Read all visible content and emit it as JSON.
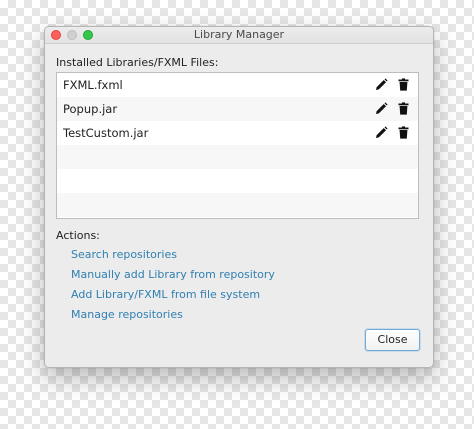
{
  "window": {
    "title": "Library Manager"
  },
  "installed": {
    "label": "Installed Libraries/FXML Files:",
    "items": [
      {
        "name": "FXML.fxml"
      },
      {
        "name": "Popup.jar"
      },
      {
        "name": "TestCustom.jar"
      }
    ]
  },
  "actions": {
    "label": "Actions:",
    "links": [
      "Search repositories",
      "Manually add Library from repository",
      "Add Library/FXML from file system",
      "Manage repositories"
    ]
  },
  "footer": {
    "close_label": "Close"
  },
  "icons": {
    "edit": "pencil-icon",
    "delete": "trash-icon"
  },
  "colors": {
    "link": "#2f7fb2",
    "focus": "#6ea9d8",
    "traffic_close": "#fc605c",
    "traffic_max": "#34c84a"
  }
}
